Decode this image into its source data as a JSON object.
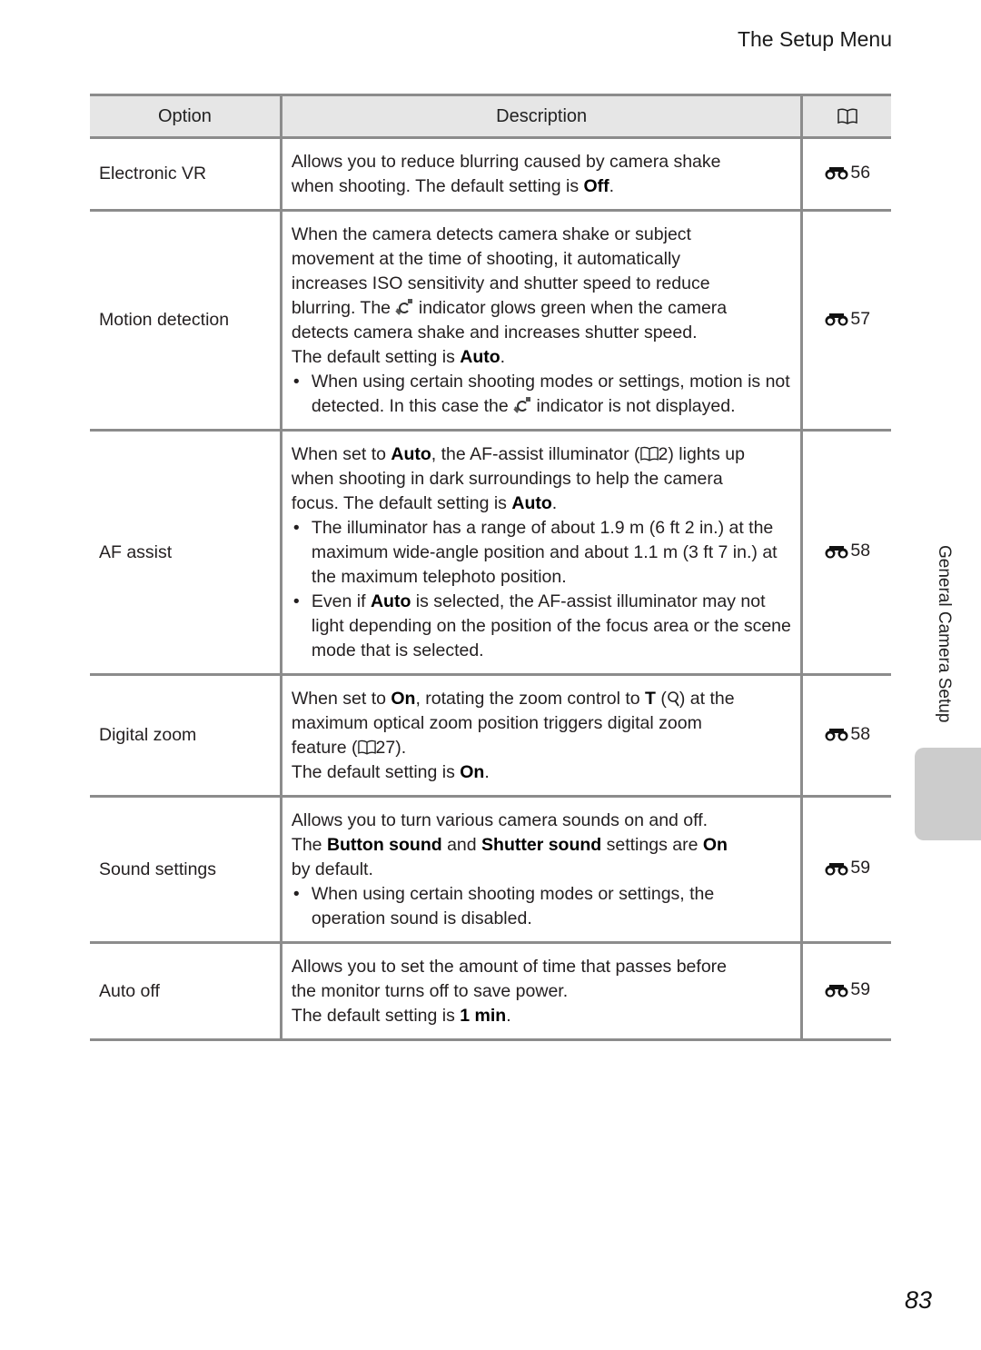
{
  "header": {
    "title": "The Setup Menu"
  },
  "table": {
    "columns": {
      "option": "Option",
      "description": "Description",
      "reference_icon": "book-icon"
    },
    "rows": [
      {
        "option": "Electronic VR",
        "ref": "56",
        "lines": [
          {
            "pre": "Allows you to reduce blurring caused by camera shake"
          },
          {
            "pre": "when shooting. The default setting is ",
            "bold": "Off",
            "post": "."
          }
        ]
      },
      {
        "option": "Motion detection",
        "ref": "57",
        "lines": [
          {
            "pre": "When the camera detects camera shake or subject"
          },
          {
            "pre": "movement at the time of shooting, it automatically"
          },
          {
            "pre": "increases ISO sensitivity and shutter speed to reduce"
          },
          {
            "pre": "blurring. The ",
            "icon": "motion-detection-icon",
            "post": " indicator glows green when the camera"
          },
          {
            "pre": "detects camera shake and increases shutter speed."
          },
          {
            "pre": "The default setting is ",
            "bold": "Auto",
            "post": "."
          }
        ],
        "bullets": [
          {
            "pre": "When using certain shooting modes or settings, motion is not detected. In this case the ",
            "icon": "motion-detection-icon",
            "post": " indicator is not displayed."
          }
        ]
      },
      {
        "option": "AF assist",
        "ref": "58",
        "lines": [
          {
            "pre": "When set to ",
            "bold": "Auto",
            "post": ", the AF-assist illuminator (",
            "page_ref": "2",
            "post2": ") lights up"
          },
          {
            "pre": "when shooting in dark surroundings to help the camera"
          },
          {
            "pre": "focus. The default setting is ",
            "bold": "Auto",
            "post": "."
          }
        ],
        "bullets": [
          {
            "pre": "The illuminator has a range of about 1.9 m (6 ft 2 in.) at the maximum wide-angle position and about 1.1 m (3 ft 7 in.) at the maximum telephoto position."
          },
          {
            "pre": "Even if ",
            "bold": "Auto",
            "post": " is selected, the AF-assist illuminator may not light depending on the position of the focus area or the scene mode that is selected."
          }
        ]
      },
      {
        "option": "Digital zoom",
        "ref": "58",
        "lines": [
          {
            "pre": "When set to ",
            "bold": "On",
            "post": ", rotating the zoom control to ",
            "bold2": "T",
            "post2": " (",
            "icon": "magnify-icon",
            "post3": ") at the"
          },
          {
            "pre": "maximum optical zoom position triggers digital zoom"
          },
          {
            "pre": "feature (",
            "page_ref": "27",
            "post": ")."
          },
          {
            "pre": "The default setting is ",
            "bold": "On",
            "post": "."
          }
        ]
      },
      {
        "option": "Sound settings",
        "ref": "59",
        "lines": [
          {
            "pre": "Allows you to turn various camera sounds on and off."
          },
          {
            "pre": "The ",
            "bold": "Button sound",
            "post": " and ",
            "bold2": "Shutter sound",
            "post2": " settings are ",
            "bold3": "On"
          },
          {
            "pre": "by default."
          }
        ],
        "bullets": [
          {
            "pre": "When using certain shooting modes or settings, the operation sound is disabled."
          }
        ]
      },
      {
        "option": "Auto off",
        "ref": "59",
        "lines": [
          {
            "pre": "Allows you to set the amount of time that passes before"
          },
          {
            "pre": "the monitor turns off to save power."
          },
          {
            "pre": "The default setting is ",
            "bold": "1 min",
            "post": "."
          }
        ]
      }
    ]
  },
  "side_tab": {
    "label": "General Camera Setup"
  },
  "footer": {
    "page_number": "83"
  }
}
